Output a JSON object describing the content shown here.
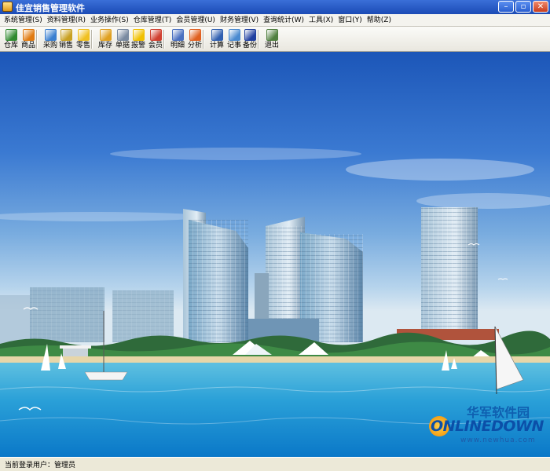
{
  "window": {
    "title": "佳宜销售管理软件",
    "controls": {
      "minimize": "–",
      "restore": "▫",
      "close": "✕"
    }
  },
  "menu": [
    {
      "id": "system",
      "label": "系统管理(S)"
    },
    {
      "id": "data",
      "label": "资料管理(R)"
    },
    {
      "id": "business",
      "label": "业务操作(S)"
    },
    {
      "id": "warehouse",
      "label": "仓库管理(T)"
    },
    {
      "id": "member",
      "label": "会员管理(U)"
    },
    {
      "id": "finance",
      "label": "财务管理(V)"
    },
    {
      "id": "query",
      "label": "查询统计(W)"
    },
    {
      "id": "tools",
      "label": "工具(X)"
    },
    {
      "id": "window",
      "label": "窗口(Y)"
    },
    {
      "id": "help",
      "label": "帮助(Z)"
    }
  ],
  "toolbar": [
    {
      "id": "warehouse",
      "label": "仓库",
      "icon": "warehouse-icon",
      "color": "#2f8a2f"
    },
    {
      "id": "goods",
      "label": "商品",
      "icon": "goods-box-icon",
      "color": "#e07a10"
    },
    {
      "id": "purchase",
      "label": "采购",
      "icon": "purchase-icon",
      "color": "#3a7fd0"
    },
    {
      "id": "sales",
      "label": "销售",
      "icon": "sales-icon",
      "color": "#c8a020"
    },
    {
      "id": "retail",
      "label": "零售",
      "icon": "retail-smiley-icon",
      "color": "#f0c020"
    },
    {
      "id": "stock",
      "label": "库存",
      "icon": "stock-icon",
      "color": "#e0a020"
    },
    {
      "id": "documents",
      "label": "单据",
      "icon": "document-icon",
      "color": "#7a8aa0"
    },
    {
      "id": "alert",
      "label": "报警",
      "icon": "alert-warning-icon",
      "color": "#f0c000"
    },
    {
      "id": "member",
      "label": "会员",
      "icon": "member-icon",
      "color": "#d04030"
    },
    {
      "id": "detail",
      "label": "明细",
      "icon": "detail-list-icon",
      "color": "#4a70c0"
    },
    {
      "id": "analysis",
      "label": "分析",
      "icon": "analysis-chart-icon",
      "color": "#e06020"
    },
    {
      "id": "calculator",
      "label": "计算",
      "icon": "calculator-icon",
      "color": "#3060b0"
    },
    {
      "id": "notes",
      "label": "记事",
      "icon": "notes-icon",
      "color": "#4a8ad0"
    },
    {
      "id": "backup",
      "label": "备份",
      "icon": "backup-disk-icon",
      "color": "#2040a0"
    },
    {
      "id": "exit",
      "label": "退出",
      "icon": "exit-door-icon",
      "color": "#508040"
    }
  ],
  "status": {
    "text": "当前登录用户：管理员"
  },
  "watermark": {
    "cn": "华军软件园",
    "en": "ONLINEDOWN",
    "url": "www.newhua.com"
  }
}
